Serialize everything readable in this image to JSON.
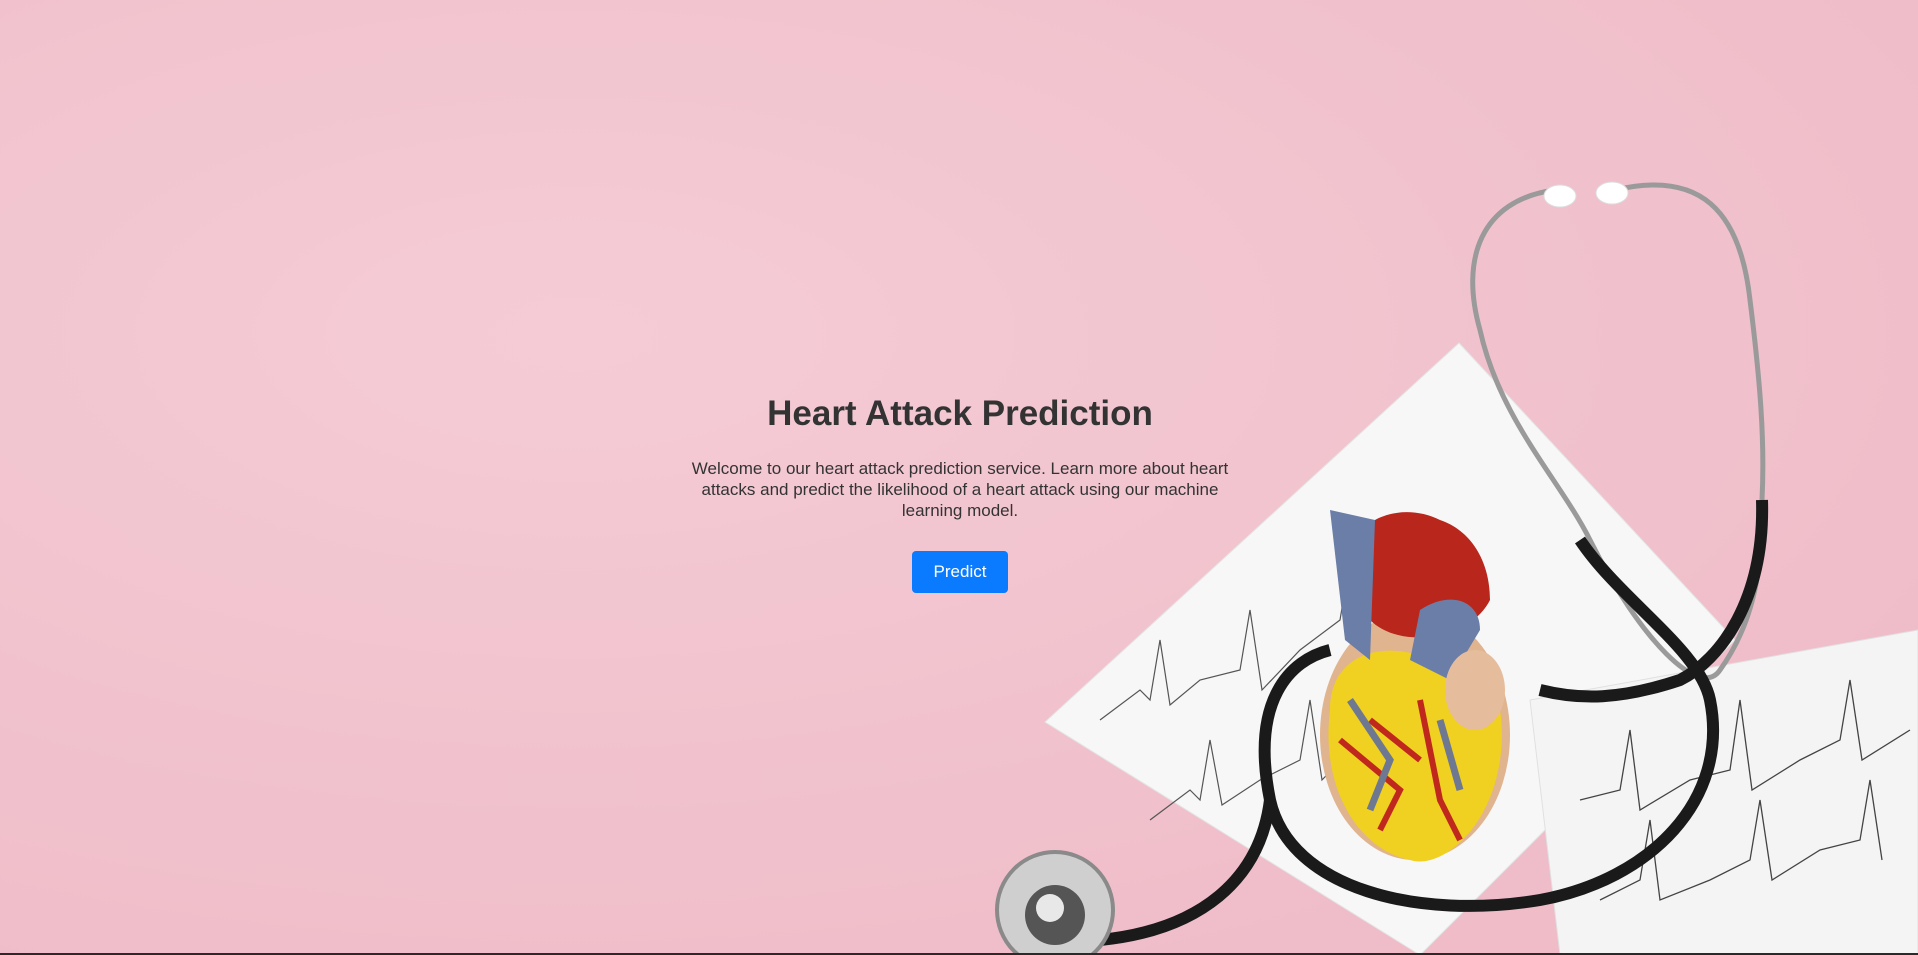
{
  "hero": {
    "title": "Heart Attack Prediction",
    "description": "Welcome to our heart attack prediction service. Learn more about heart attacks and predict the likelihood of a heart attack using our machine learning model.",
    "button_label": "Predict"
  },
  "background": {
    "image_subject": "heart-model-with-stethoscope-and-ecg-paper",
    "base_color": "#f2c5d0"
  },
  "colors": {
    "text": "#333333",
    "button": "#0a7bff",
    "button_text": "#ffffff"
  }
}
